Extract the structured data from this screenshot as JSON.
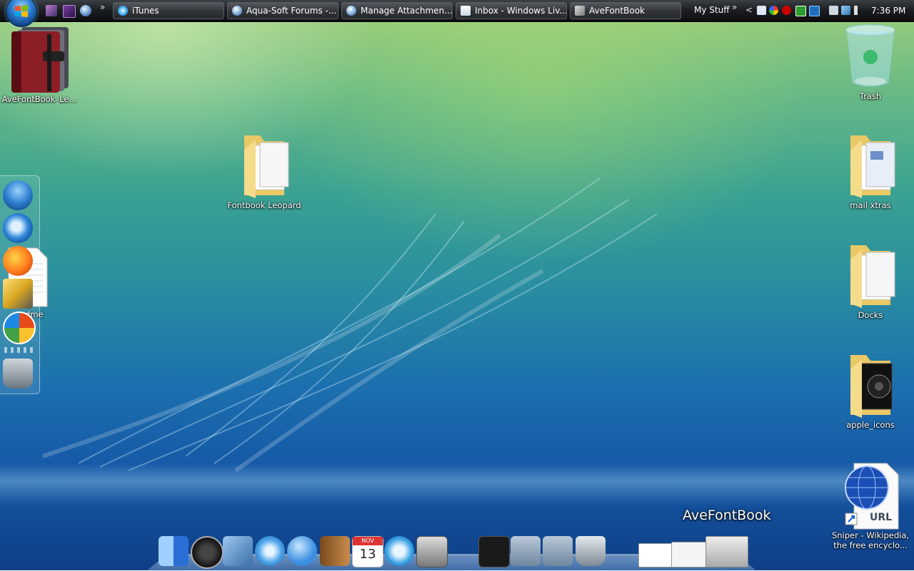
{
  "taskbar": {
    "quick_launch": [
      "media-icon",
      "purple-app-icon",
      "globe-icon"
    ],
    "overflow_glyph": "»",
    "tasks": [
      {
        "label": "iTunes",
        "icon": "itunes-icon"
      },
      {
        "label": "Aqua-Soft Forums -...",
        "icon": "browser-icon"
      },
      {
        "label": "Manage Attachmen...",
        "icon": "browser-icon"
      },
      {
        "label": "Inbox - Windows Liv...",
        "icon": "mail-icon"
      },
      {
        "label": "AveFontBook",
        "icon": "fontbook-icon"
      }
    ],
    "toolbar_label": "My Stuff",
    "toolbar_chevron": "»",
    "tray_expand": "<",
    "clock": "7:36 PM"
  },
  "desktop_icons": [
    {
      "label": "AveFontBook_Le...",
      "icon": "fontbook-icon"
    },
    {
      "label": "Fontbook Leopard",
      "icon": "folder-icon"
    },
    {
      "label": "adme",
      "icon": "text-document-icon"
    },
    {
      "label": "Trash",
      "icon": "recycle-bin-icon"
    },
    {
      "label": "mail xtras",
      "icon": "folder-icon"
    },
    {
      "label": "Docks",
      "icon": "folder-icon"
    },
    {
      "label": "apple_icons",
      "icon": "folder-icon"
    },
    {
      "label": "Sniper - Wikipedia,",
      "label2": "the free encyclo...",
      "icon": "url-shortcut-icon",
      "badge": "URL"
    }
  ],
  "side_dock": [
    "windows-orb-icon",
    "internet-explorer-icon",
    "firefox-icon",
    "tools-icon",
    "office-icon",
    "trash-can-icon"
  ],
  "bottom_dock": {
    "hover_label": "AveFontBook",
    "calendar_month": "NOV",
    "calendar_day": "13",
    "items": [
      "finder-icon",
      "dashboard-icon",
      "mail-icon",
      "safari-icon",
      "ichat-icon",
      "address-book-icon",
      "ical-icon",
      "itunes-icon",
      "system-preferences-icon",
      "pirate-folder-icon",
      "user-folder-icon",
      "applications-folder-icon",
      "trash-can-icon",
      "window-thumbnail-icon",
      "window-thumbnail-icon",
      "window-thumbnail-icon"
    ]
  }
}
